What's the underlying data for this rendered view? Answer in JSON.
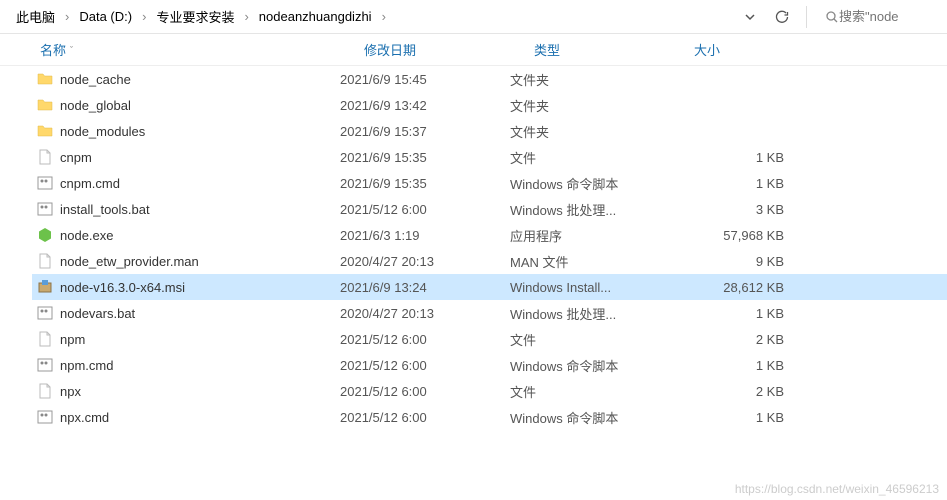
{
  "breadcrumb": [
    "此电脑",
    "Data (D:)",
    "专业要求安装",
    "nodeanzhuangdizhi"
  ],
  "search": {
    "placeholder": "搜索\"node"
  },
  "columns": {
    "name": "名称",
    "date": "修改日期",
    "type": "类型",
    "size": "大小"
  },
  "files": [
    {
      "icon": "folder",
      "name": "node_cache",
      "date": "2021/6/9 15:45",
      "type": "文件夹",
      "size": ""
    },
    {
      "icon": "folder",
      "name": "node_global",
      "date": "2021/6/9 13:42",
      "type": "文件夹",
      "size": ""
    },
    {
      "icon": "folder",
      "name": "node_modules",
      "date": "2021/6/9 15:37",
      "type": "文件夹",
      "size": ""
    },
    {
      "icon": "file",
      "name": "cnpm",
      "date": "2021/6/9 15:35",
      "type": "文件",
      "size": "1 KB"
    },
    {
      "icon": "cmd",
      "name": "cnpm.cmd",
      "date": "2021/6/9 15:35",
      "type": "Windows 命令脚本",
      "size": "1 KB"
    },
    {
      "icon": "cmd",
      "name": "install_tools.bat",
      "date": "2021/5/12 6:00",
      "type": "Windows 批处理...",
      "size": "3 KB"
    },
    {
      "icon": "node",
      "name": "node.exe",
      "date": "2021/6/3 1:19",
      "type": "应用程序",
      "size": "57,968 KB"
    },
    {
      "icon": "file",
      "name": "node_etw_provider.man",
      "date": "2020/4/27 20:13",
      "type": "MAN 文件",
      "size": "9 KB"
    },
    {
      "icon": "msi",
      "name": "node-v16.3.0-x64.msi",
      "date": "2021/6/9 13:24",
      "type": "Windows Install...",
      "size": "28,612 KB",
      "selected": true
    },
    {
      "icon": "cmd",
      "name": "nodevars.bat",
      "date": "2020/4/27 20:13",
      "type": "Windows 批处理...",
      "size": "1 KB"
    },
    {
      "icon": "file",
      "name": "npm",
      "date": "2021/5/12 6:00",
      "type": "文件",
      "size": "2 KB"
    },
    {
      "icon": "cmd",
      "name": "npm.cmd",
      "date": "2021/5/12 6:00",
      "type": "Windows 命令脚本",
      "size": "1 KB"
    },
    {
      "icon": "file",
      "name": "npx",
      "date": "2021/5/12 6:00",
      "type": "文件",
      "size": "2 KB"
    },
    {
      "icon": "cmd",
      "name": "npx.cmd",
      "date": "2021/5/12 6:00",
      "type": "Windows 命令脚本",
      "size": "1 KB"
    }
  ],
  "watermark": "https://blog.csdn.net/weixin_46596213"
}
